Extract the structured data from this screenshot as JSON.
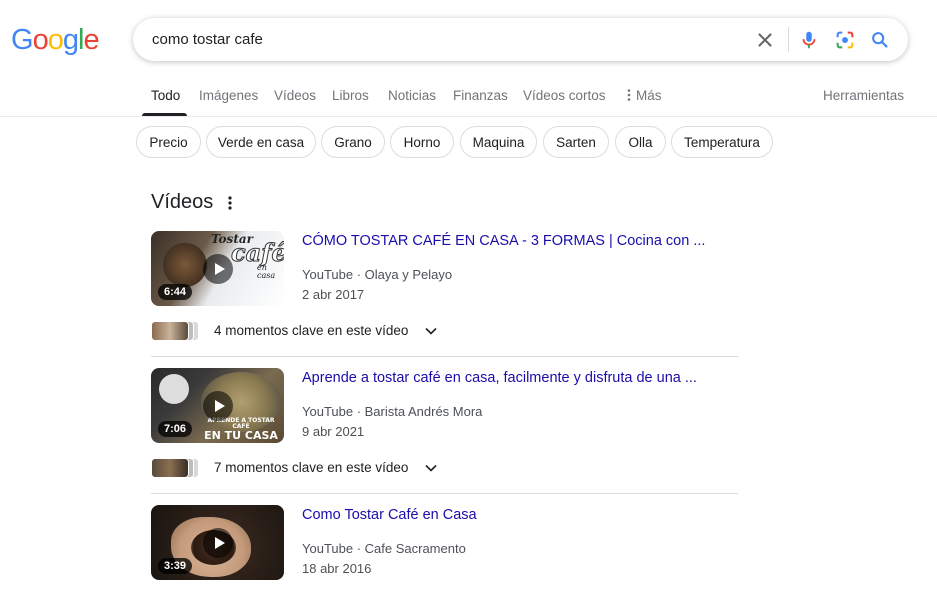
{
  "logo": {
    "letters": [
      "G",
      "o",
      "o",
      "g",
      "l",
      "e"
    ],
    "colors": [
      "#4285F4",
      "#EA4335",
      "#FBBC05",
      "#4285F4",
      "#34A853",
      "#EA4335"
    ]
  },
  "search": {
    "query": "como tostar cafe",
    "icons": [
      "close-icon",
      "mic-icon",
      "google-lens-icon",
      "search-icon"
    ]
  },
  "tabs": [
    {
      "label": "Todo",
      "active": true
    },
    {
      "label": "Imágenes"
    },
    {
      "label": "Vídeos"
    },
    {
      "label": "Libros"
    },
    {
      "label": "Noticias"
    },
    {
      "label": "Finanzas"
    },
    {
      "label": "Vídeos cortos"
    },
    {
      "label": "Más"
    }
  ],
  "tools_label": "Herramientas",
  "chips": [
    "Precio",
    "Verde en casa",
    "Grano",
    "Horno",
    "Maquina",
    "Sarten",
    "Olla",
    "Temperatura"
  ],
  "videos_section": {
    "title": "Vídeos",
    "items": [
      {
        "title": "CÓMO TOSTAR CAFÉ EN CASA - 3 FORMAS | Cocina con ...",
        "source": "YouTube · Olaya y Pelayo",
        "date": "2 abr 2017",
        "duration": "6:44",
        "thumb_text": [
          "Tostar",
          "café",
          "en casa"
        ],
        "moments": "4 momentos clave en este vídeo"
      },
      {
        "title": "Aprende a tostar café en casa, facilmente y disfruta de una ...",
        "source": "YouTube · Barista Andrés Mora",
        "date": "9 abr 2021",
        "duration": "7:06",
        "thumb_text": [
          "APRENDE A TOSTAR CAFÉ",
          "EN TU CASA"
        ],
        "moments": "7 momentos clave en este vídeo"
      },
      {
        "title": "Como Tostar Café en Casa",
        "source": "YouTube · Cafe Sacramento",
        "date": "18 abr 2016",
        "duration": "3:39"
      }
    ]
  },
  "colors": {
    "link": "#1a0dab",
    "muted": "#70757a",
    "border": "#dadce0"
  }
}
